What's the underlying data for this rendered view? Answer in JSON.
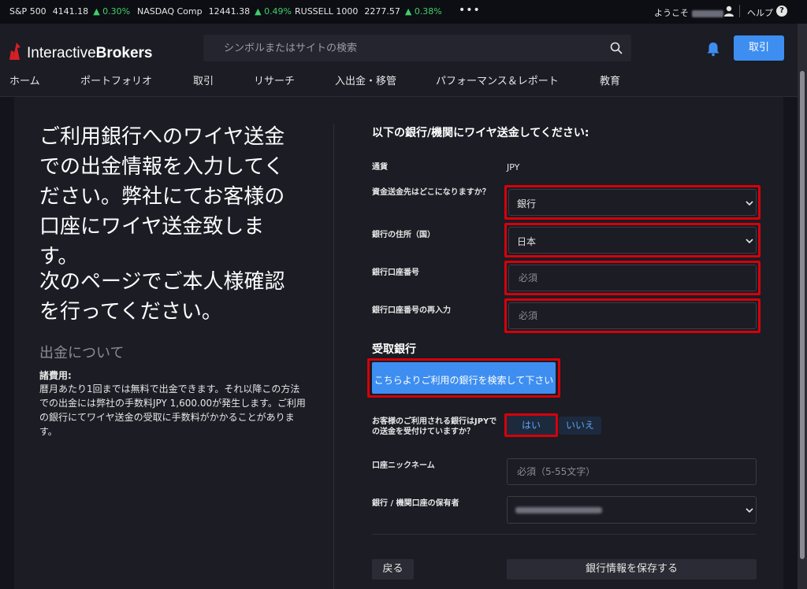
{
  "ticker": {
    "items": [
      {
        "name": "S&P 500",
        "value": "4141.18",
        "change": "▲ 0.30%"
      },
      {
        "name": "NASDAQ Comp",
        "value": "12441.38",
        "change": "▲ 0.49%"
      },
      {
        "name": "RUSSELL 1000",
        "value": "2277.57",
        "change": "▲ 0.38%"
      }
    ],
    "more": "•••",
    "welcome": "ようこそ",
    "help": "ヘルプ",
    "help_icon": "?"
  },
  "header": {
    "logo_light": "Interactive",
    "logo_bold": "Brokers",
    "search_placeholder": "シンボルまたはサイトの検索",
    "trade_button": "取引",
    "nav": [
      "ホーム",
      "ポートフォリオ",
      "取引",
      "リサーチ",
      "入出金・移管",
      "パフォーマンス＆レポート",
      "教育"
    ]
  },
  "left": {
    "lead": "ご利用銀行へのワイヤ送金での出金情報を入力してください。弊社にてお客様の口座にワイヤ送金致します。",
    "lead2": "次のページでご本人様確認を行ってください。",
    "about": "出金について",
    "fee_title": "諸費用:",
    "fee_body": "暦月あたり1回までは無料で出金できます。それ以降この方法での出金には弊社の手数料JPY 1,600.00が発生します。ご利用の銀行にてワイヤ送金の受取に手数料がかかることがあります。"
  },
  "form": {
    "title": "以下の銀行/機関にワイヤ送金してください:",
    "currency_label": "通貨",
    "currency_value": "JPY",
    "destination_label": "資金送金先はどこになりますか？",
    "destination_value": "銀行",
    "country_label": "銀行の住所（国）",
    "country_value": "日本",
    "account_label": "銀行口座番号",
    "account_placeholder": "必須",
    "account_confirm_label": "銀行口座番号の再入力",
    "account_confirm_placeholder": "必須",
    "section_title": "受取銀行",
    "search_bank_button": "こちらよりご利用の銀行を検索して下さい",
    "accepts_label": "お客様のご利用される銀行はJPYでの送金を受付けていますか？",
    "yes": "はい",
    "no": "いいえ",
    "nickname_label": "口座ニックネーム",
    "nickname_placeholder": "必須（5-55文字）",
    "holder_label": "銀行 / 機関口座の保有者",
    "back_button": "戻る",
    "save_button": "銀行情報を保存する"
  },
  "colors": {
    "accent": "#3d8ef0",
    "highlight": "#d6000a",
    "positive": "#3fcf6b"
  }
}
